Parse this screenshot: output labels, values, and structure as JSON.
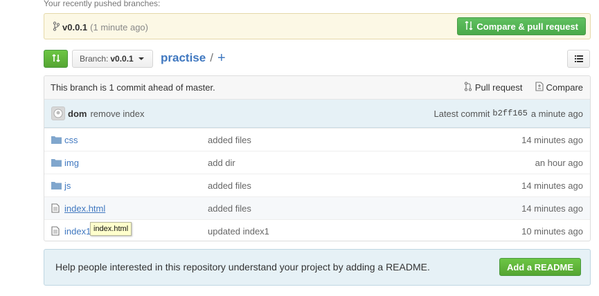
{
  "recent": {
    "title": "Your recently pushed branches:",
    "branch": "v0.0.1",
    "time": "(1 minute ago)",
    "compare_label": "Compare & pull request"
  },
  "toolbar": {
    "branch_prefix": "Branch:",
    "branch_name": "v0.0.1",
    "repo_name": "practise",
    "separator": "/",
    "plus": "+"
  },
  "branch_info": {
    "text": "This branch is 1 commit ahead of master.",
    "pull_request_label": "Pull request",
    "compare_label": "Compare"
  },
  "latest_commit": {
    "author": "dom",
    "message": "remove index",
    "prefix": "Latest commit",
    "sha": "b2ff165",
    "age": "a minute ago"
  },
  "files": [
    {
      "type": "folder",
      "name": "css",
      "message": "added files",
      "age": "14 minutes ago"
    },
    {
      "type": "folder",
      "name": "img",
      "message": "add dir",
      "age": "an hour ago"
    },
    {
      "type": "folder",
      "name": "js",
      "message": "added files",
      "age": "14 minutes ago"
    },
    {
      "type": "file",
      "name": "index.html",
      "message": "added files",
      "age": "14 minutes ago"
    },
    {
      "type": "file",
      "name": "index1",
      "message": "updated index1",
      "age": "10 minutes ago"
    }
  ],
  "tooltip": "index.html",
  "readme": {
    "text": "Help people interested in this repository understand your project by adding a README.",
    "button_label": "Add a README"
  },
  "colors": {
    "link": "#4078c0",
    "green": "#6cc644",
    "recent_bg": "#fcf8e5",
    "commit_bg": "#e6f1f6"
  }
}
